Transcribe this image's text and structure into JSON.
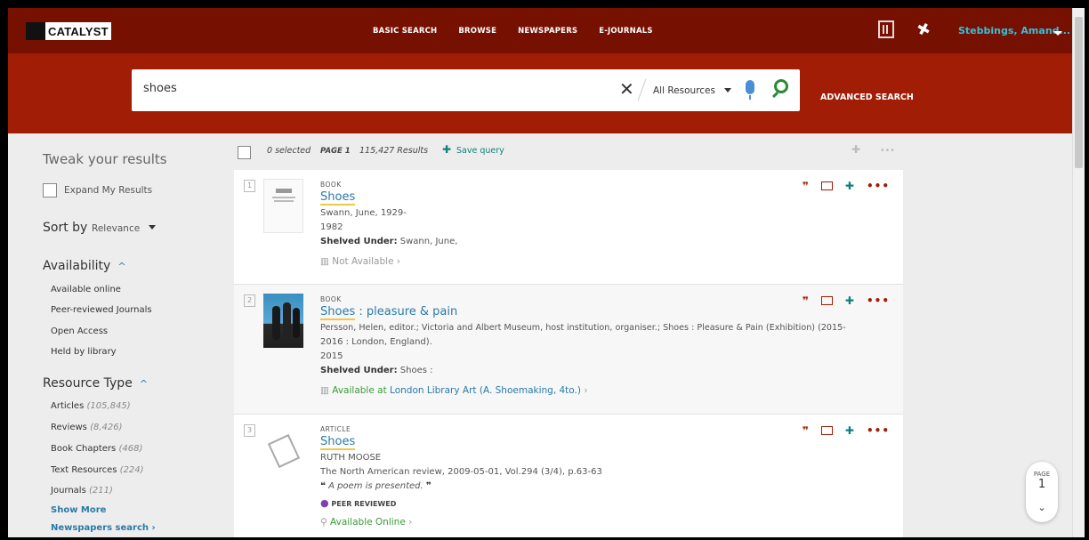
{
  "header": {
    "logo_text": "CATALYST",
    "nav": [
      "BASIC SEARCH",
      "BROWSE",
      "NEWSPAPERS",
      "E-JOURNALS"
    ],
    "user_name": "Stebbings, Amand..."
  },
  "search": {
    "query": "shoes",
    "scope": "All Resources",
    "advanced_label": "ADVANCED SEARCH"
  },
  "sidebar": {
    "tweak_title": "Tweak your results",
    "expand_label": "Expand My Results",
    "sort_label": "Sort by",
    "sort_value": "Relevance",
    "availability_title": "Availability",
    "availability_items": [
      "Available online",
      "Peer-reviewed Journals",
      "Open Access",
      "Held by library"
    ],
    "resource_title": "Resource Type",
    "resource_items": [
      {
        "label": "Articles",
        "count": "(105,845)"
      },
      {
        "label": "Reviews",
        "count": "(8,426)"
      },
      {
        "label": "Book Chapters",
        "count": "(468)"
      },
      {
        "label": "Text Resources",
        "count": "(224)"
      },
      {
        "label": "Journals",
        "count": "(211)"
      }
    ],
    "show_more": "Show More",
    "newspapers_search": "Newspapers search"
  },
  "main": {
    "selected": "0 selected",
    "page": "PAGE 1",
    "results_count": "115,427 Results",
    "save_query": "Save query",
    "results": [
      {
        "index": "1",
        "type": "BOOK",
        "title": "Shoes",
        "lines": [
          "Swann, June, 1929-",
          "1982"
        ],
        "shelved_label": "Shelved Under:",
        "shelved_value": "Swann, June,",
        "availability": "Not Available"
      },
      {
        "index": "2",
        "type": "BOOK",
        "title_main": "Shoes",
        "title_rest": " : pleasure & pain",
        "lines": [
          "Persson, Helen, editor.; Victoria and Albert Museum, host institution, organiser.; Shoes : Pleasure & Pain (Exhibition) (2015-",
          "2016 : London, England).",
          "2015"
        ],
        "shelved_label": "Shelved Under:",
        "shelved_value": "Shoes :",
        "availability": "Available at",
        "availability_location": "London Library",
        "availability_shelf": "Art (A. Shoemaking, 4to.)"
      },
      {
        "index": "3",
        "type": "ARTICLE",
        "title": "Shoes",
        "meta": [
          "RUTH MOOSE",
          "The North American review, 2009-05-01, Vol.294 (3/4), p.63-63"
        ],
        "snippet": "A poem is presented.",
        "peer_reviewed": "PEER REVIEWED",
        "availability": "Available Online"
      }
    ]
  },
  "page_widget": {
    "label": "PAGE",
    "number": "1"
  },
  "colors": {
    "header": "#761102",
    "band": "#a11d05",
    "link": "#2a7aa8",
    "available": "#3c9a3c",
    "pin": "#11807b"
  }
}
